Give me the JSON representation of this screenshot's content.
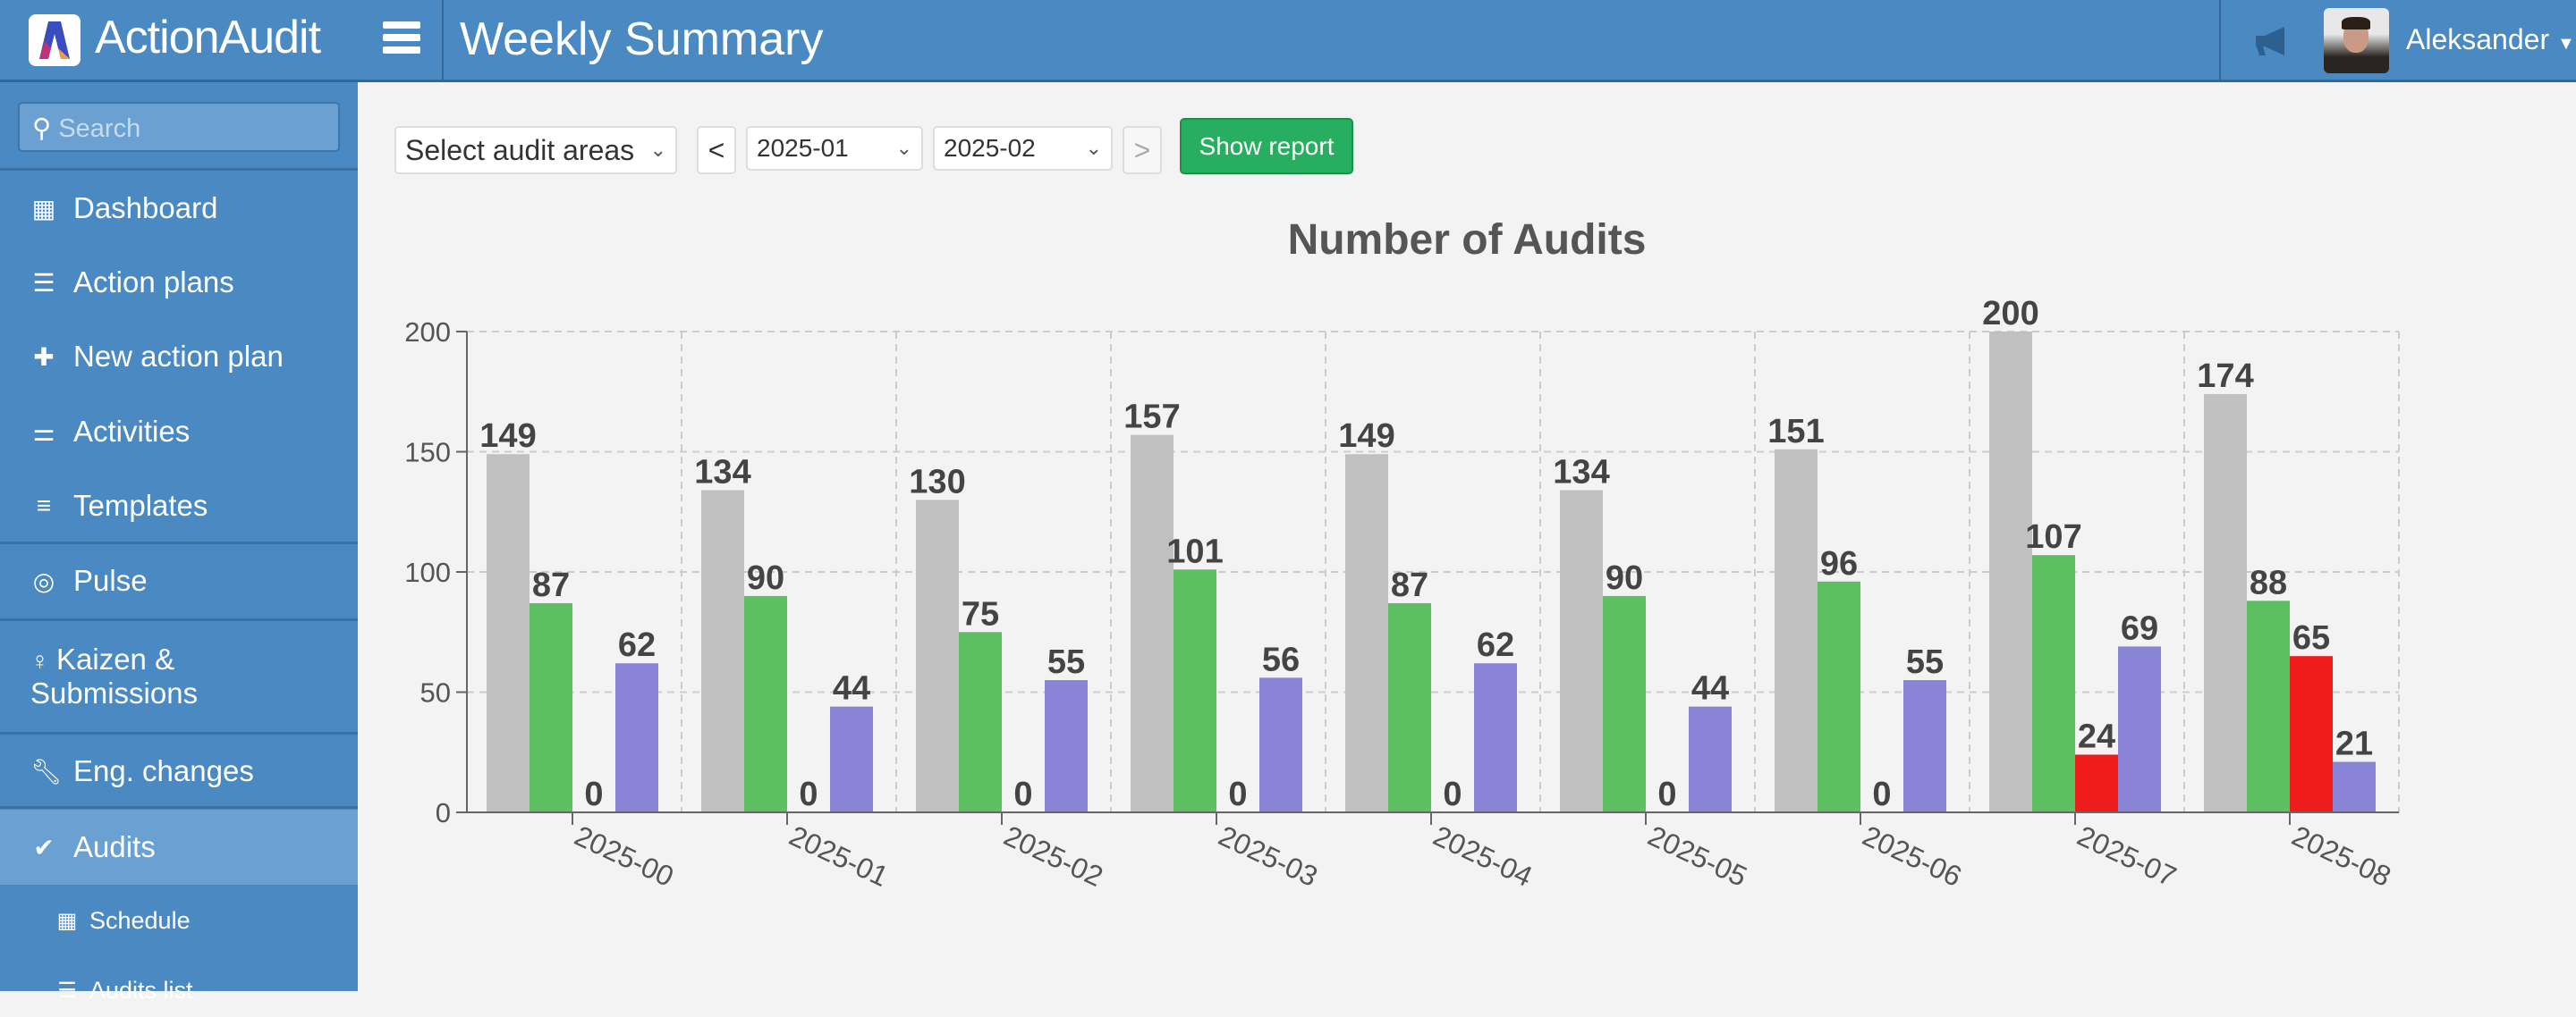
{
  "header": {
    "brand": "ActionAudit",
    "title": "Weekly Summary",
    "user": "Aleksander",
    "icons": [
      "logo",
      "menu-icon",
      "megaphone-icon",
      "avatar",
      "caret-down-icon"
    ]
  },
  "sidebar": {
    "search_placeholder": "Search",
    "items": [
      {
        "label": "Dashboard",
        "icon": "calendar-icon"
      },
      {
        "label": "Action plans",
        "icon": "server-icon"
      },
      {
        "label": "New action plan",
        "icon": "plus-icon"
      },
      {
        "label": "Activities",
        "icon": "sliders-icon"
      },
      {
        "label": "Templates",
        "icon": "list-icon"
      },
      {
        "label": "Pulse",
        "icon": "target-icon"
      },
      {
        "label": "Kaizen &",
        "label2": "Submissions",
        "icon": "lightbulb-icon"
      },
      {
        "label": "Eng. changes",
        "icon": "wrench-icon"
      },
      {
        "label": "Audits",
        "icon": "check-icon",
        "active": true
      },
      {
        "label": "Schedule",
        "icon": "calendar-icon"
      },
      {
        "label": "Audits list",
        "icon": "server-icon"
      }
    ]
  },
  "controls": {
    "areas": "Select audit areas",
    "prev": "<",
    "from": "2025-01",
    "to": "2025-02",
    "next": ">",
    "show": "Show report"
  },
  "chart_data": {
    "type": "bar",
    "title": "Number of Audits",
    "xlabel": "",
    "ylabel": "",
    "ylim": [
      0,
      200
    ],
    "yticks": [
      0,
      50,
      100,
      150,
      200
    ],
    "grid": true,
    "legend": "none",
    "categories": [
      "2025-00",
      "2025-01",
      "2025-02",
      "2025-03",
      "2025-04",
      "2025-05",
      "2025-06",
      "2025-07",
      "2025-08"
    ],
    "series": [
      {
        "color": "#c0c0c0",
        "values": [
          149,
          134,
          130,
          157,
          149,
          134,
          151,
          200,
          174
        ]
      },
      {
        "color": "#5cbf60",
        "values": [
          87,
          90,
          75,
          101,
          87,
          90,
          96,
          107,
          88
        ]
      },
      {
        "color": "#ee1c1c",
        "values": [
          0,
          0,
          0,
          0,
          0,
          0,
          0,
          24,
          65
        ]
      },
      {
        "color": "#8a84d6",
        "values": [
          62,
          44,
          55,
          56,
          62,
          44,
          55,
          69,
          21
        ]
      }
    ]
  }
}
